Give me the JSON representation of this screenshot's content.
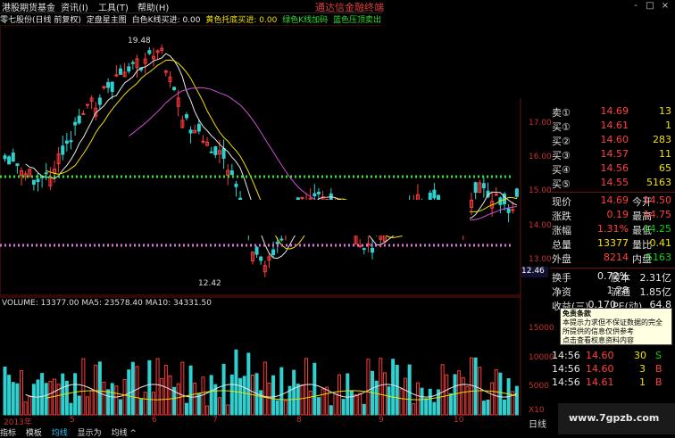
{
  "menubar": {
    "items": [
      "港股期货基金",
      "资讯(I)",
      "工具(T)",
      "帮助(H)"
    ],
    "brand": "通达信金融终端",
    "win_buttons": [
      "-",
      "□",
      "×"
    ]
  },
  "infobar": {
    "stock": "零七股份(日线 前复权)",
    "indicator": "定盘星主图",
    "white_k": "白色K线买进: 0.00",
    "yellow_support": "黄色托底买进: 0.00",
    "green_k": "绿色K线加码",
    "blue_pressure": "蓝色压顶卖出: 0.00",
    "colors": {
      "white": "#e8e8e8",
      "yellow": "#f0e000",
      "green": "#30e030",
      "magenta": "#e050e0",
      "blue": "#30c0f0"
    }
  },
  "price_axis": {
    "labels": [
      "17.00",
      "16.00",
      "15.00",
      "14.00",
      "13.00",
      "12.46"
    ],
    "annotations": {
      "high": "19.48",
      "low": "12.42"
    }
  },
  "volume": {
    "title": "VOLUME: 13377.00  MA5: 23578.40  MA10: 34331.50",
    "axis_labels": [
      "15000",
      "10000",
      "5000",
      "X10"
    ]
  },
  "quote": {
    "asks": [
      {
        "label": "卖①",
        "price": "14.69",
        "vol": "13"
      }
    ],
    "bids": [
      {
        "label": "买①",
        "price": "14.61",
        "vol": "1"
      },
      {
        "label": "买②",
        "price": "14.60",
        "vol": "283"
      },
      {
        "label": "买③",
        "price": "14.57",
        "vol": "11"
      },
      {
        "label": "买④",
        "price": "14.56",
        "vol": "65"
      },
      {
        "label": "买⑤",
        "price": "14.55",
        "vol": "5163"
      }
    ],
    "stats": [
      {
        "k1": "现价",
        "v1": "14.69",
        "k2": "今开",
        "v2": "14.50"
      },
      {
        "k1": "涨跌",
        "v1": "0.19",
        "k2": "最高",
        "v2": "14.75"
      },
      {
        "k1": "涨幅",
        "v1": "1.31%",
        "k2": "最低",
        "v2": "14.25"
      },
      {
        "k1": "总量",
        "v1": "13377",
        "k2": "量比",
        "v2": "0.41"
      },
      {
        "k1": "外盘",
        "v1": "8214",
        "k2": "内盘",
        "v2": "5163"
      }
    ],
    "stats2": [
      {
        "k1": "换手",
        "v1": "0.72%",
        "k2": "股本",
        "v2": "2.31亿"
      },
      {
        "k1": "净资",
        "v1": "1.28",
        "k2": "流通",
        "v2": "1.85亿"
      },
      {
        "k1": "收益(三)",
        "v1": "0.170",
        "k2": "PE(动)",
        "v2": "64.8"
      }
    ]
  },
  "tooltip": {
    "title": "免责条款",
    "lines": [
      "本提示力求但不保证数据的完全",
      "所提供的信息仅供参考",
      "点击查看权息资料内容"
    ]
  },
  "ticks": [
    {
      "time": "14:55",
      "price": "14.70",
      "vol": "",
      "flag": ""
    },
    {
      "time": "14:56",
      "price": "14.60",
      "vol": "30",
      "flag": "S"
    },
    {
      "time": "14:56",
      "price": "14.60",
      "vol": "3",
      "flag": "B"
    },
    {
      "time": "14:56",
      "price": "14.61",
      "vol": "1",
      "flag": "B"
    }
  ],
  "dates": [
    "2013年",
    "5",
    "6",
    "7",
    "8",
    "9",
    "10"
  ],
  "tabs": [
    "指标",
    "模板",
    "均线",
    "显示为",
    "均线 ^"
  ],
  "day_label": "日线",
  "watermark": "www.7gpzb.com",
  "last_price_tag": "12.46"
}
